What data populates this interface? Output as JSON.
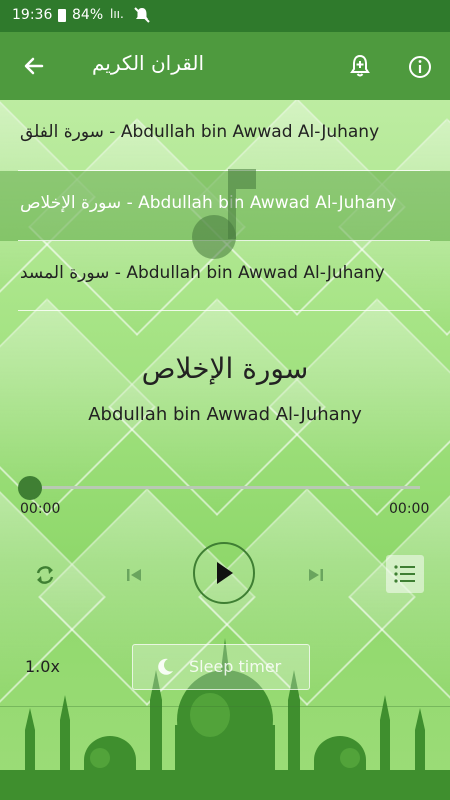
{
  "status_bar": {
    "time": "19:36",
    "battery": "84%",
    "signal": "lıı."
  },
  "app_bar": {
    "title": "القران الكريم"
  },
  "playlist": [
    {
      "surah": "سورة الفلق",
      "reciter": "Abdullah bin Awwad Al-Juhany",
      "active": false
    },
    {
      "surah": "سورة الإخلاص",
      "reciter": "Abdullah bin Awwad Al-Juhany",
      "active": true
    },
    {
      "surah": "سورة المسد",
      "reciter": "Abdullah bin Awwad Al-Juhany",
      "active": false
    }
  ],
  "now_playing": {
    "title": "سورة الإخلاص",
    "artist": "Abdullah bin Awwad Al-Juhany",
    "current_time": "00:00",
    "total_time": "00:00",
    "progress": 0
  },
  "controls": {
    "speed": "1.0x",
    "sleep_timer_label": "Sleep timer"
  },
  "colors": {
    "status_bar": "#2f7a2c",
    "app_bar": "#4e9a3e",
    "accent": "#3f7f33"
  },
  "icons": [
    "back-arrow-icon",
    "bell-add-icon",
    "info-icon",
    "music-note-icon",
    "repeat-icon",
    "skip-previous-icon",
    "play-icon",
    "skip-next-icon",
    "playlist-icon",
    "moon-icon"
  ]
}
